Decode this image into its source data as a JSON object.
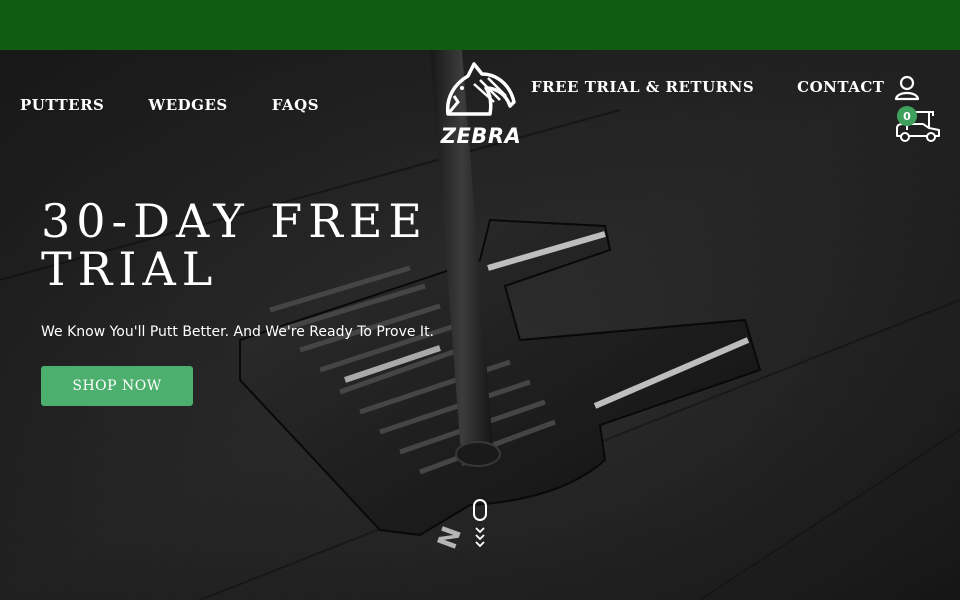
{
  "nav": {
    "left": [
      {
        "label": "PUTTERS"
      },
      {
        "label": "WEDGES"
      },
      {
        "label": "FAQS"
      }
    ],
    "right": [
      {
        "label": "FREE TRIAL & RETURNS"
      },
      {
        "label": "CONTACT"
      }
    ]
  },
  "brand": {
    "logo_text": "ZEBRA",
    "icon": "zebra-head-icon"
  },
  "header_icons": {
    "account": "user-icon",
    "cart": "golf-cart-icon",
    "cart_count": "0"
  },
  "hero": {
    "title": "30-DAY FREE TRIAL",
    "subtitle": "We Know You'll Putt Better. And We're Ready To Prove It.",
    "cta_label": "SHOP NOW",
    "scroll_icon": "scroll-down-icon"
  },
  "colors": {
    "topbar": "#0f5c12",
    "cta": "#4caf6e",
    "badge": "#3fa05d"
  }
}
